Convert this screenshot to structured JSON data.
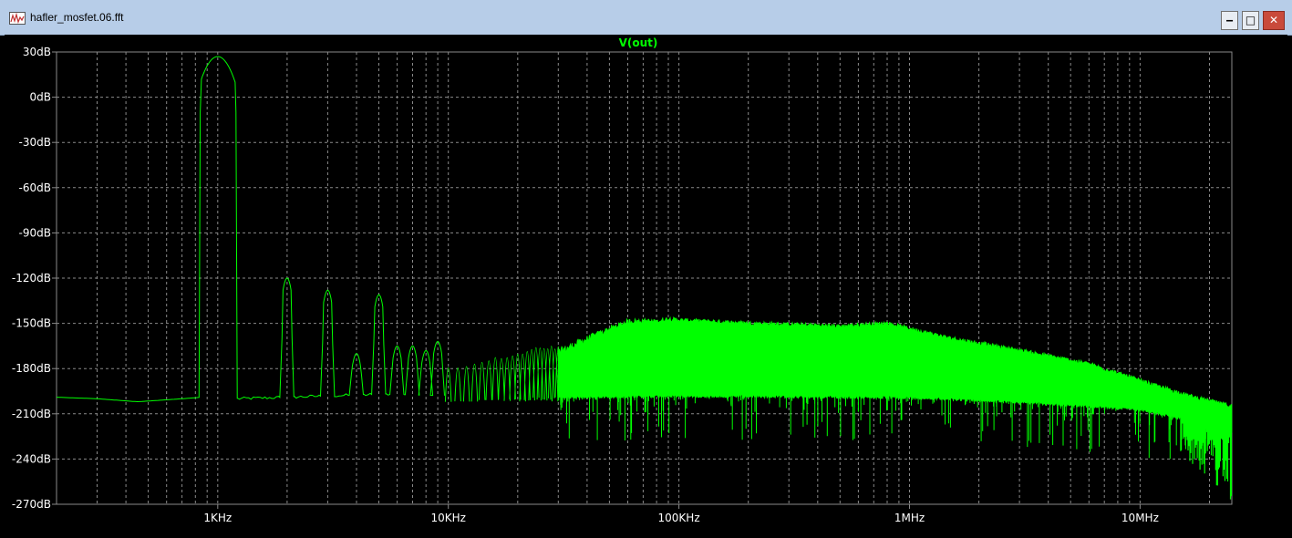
{
  "window": {
    "title": "hafler_mosfet.06.fft",
    "icon": "waveform-app-icon",
    "controls": {
      "minimize": "‒",
      "maximize": "□",
      "close": "✕"
    }
  },
  "colors": {
    "background": "#000000",
    "grid": "#8a8a8a",
    "trace": "#00ff00",
    "axis_text": "#ffffff",
    "title_text": "#00ff00",
    "titlebar": "#b7cde8"
  },
  "chart_data": {
    "type": "line",
    "title": "V(out)",
    "xscale": "log",
    "xlim": [
      200,
      25000000
    ],
    "ylim": [
      -270,
      30
    ],
    "grid": true,
    "y_ticks": [
      30,
      0,
      -30,
      -60,
      -90,
      -120,
      -150,
      -180,
      -210,
      -240,
      -270
    ],
    "y_tick_labels": [
      "30dB",
      "0dB",
      "-30dB",
      "-60dB",
      "-90dB",
      "-120dB",
      "-150dB",
      "-180dB",
      "-210dB",
      "-240dB",
      "-270dB"
    ],
    "x_ticks": [
      1000,
      10000,
      100000,
      1000000,
      10000000
    ],
    "x_tick_labels": [
      "1KHz",
      "10KHz",
      "100KHz",
      "1MHz",
      "10MHz"
    ],
    "series": [
      {
        "fundamental": {
          "x": 1000,
          "y": 27
        },
        "harmonics": [
          {
            "x": 2000,
            "y": -120
          },
          {
            "x": 3000,
            "y": -128
          },
          {
            "x": 4000,
            "y": -170
          },
          {
            "x": 5000,
            "y": -131
          },
          {
            "x": 6000,
            "y": -165
          },
          {
            "x": 7000,
            "y": -165
          },
          {
            "x": 8000,
            "y": -168
          },
          {
            "x": 9000,
            "y": -162
          }
        ],
        "noise_floor": [
          {
            "x": 200,
            "y": -199
          },
          {
            "x": 300,
            "y": -200
          },
          {
            "x": 450,
            "y": -202
          },
          {
            "x": 700,
            "y": -200
          },
          {
            "x": 850,
            "y": -199
          },
          {
            "x": 1200,
            "y": -200
          },
          {
            "x": 2000,
            "y": -199
          },
          {
            "x": 5000,
            "y": -197
          },
          {
            "x": 10000,
            "y": -198
          },
          {
            "x": 100000,
            "y": -196
          },
          {
            "x": 1000000,
            "y": -197
          },
          {
            "x": 3000000,
            "y": -200
          },
          {
            "x": 10000000,
            "y": -205
          },
          {
            "x": 20000000,
            "y": -215
          },
          {
            "x": 25000000,
            "y": -220
          }
        ],
        "peak_envelope": [
          {
            "x": 10000,
            "y": -162
          },
          {
            "x": 15000,
            "y": -152
          },
          {
            "x": 25000,
            "y": -136
          },
          {
            "x": 40000,
            "y": -136
          },
          {
            "x": 60000,
            "y": -137
          },
          {
            "x": 80000,
            "y": -146
          },
          {
            "x": 100000,
            "y": -148
          },
          {
            "x": 200000,
            "y": -150
          },
          {
            "x": 500000,
            "y": -152
          },
          {
            "x": 800000,
            "y": -150
          },
          {
            "x": 1500000,
            "y": -160
          },
          {
            "x": 3000000,
            "y": -168
          },
          {
            "x": 6000000,
            "y": -177
          },
          {
            "x": 12000000,
            "y": -192
          },
          {
            "x": 18000000,
            "y": -200
          },
          {
            "x": 25000000,
            "y": -205
          }
        ]
      }
    ]
  }
}
